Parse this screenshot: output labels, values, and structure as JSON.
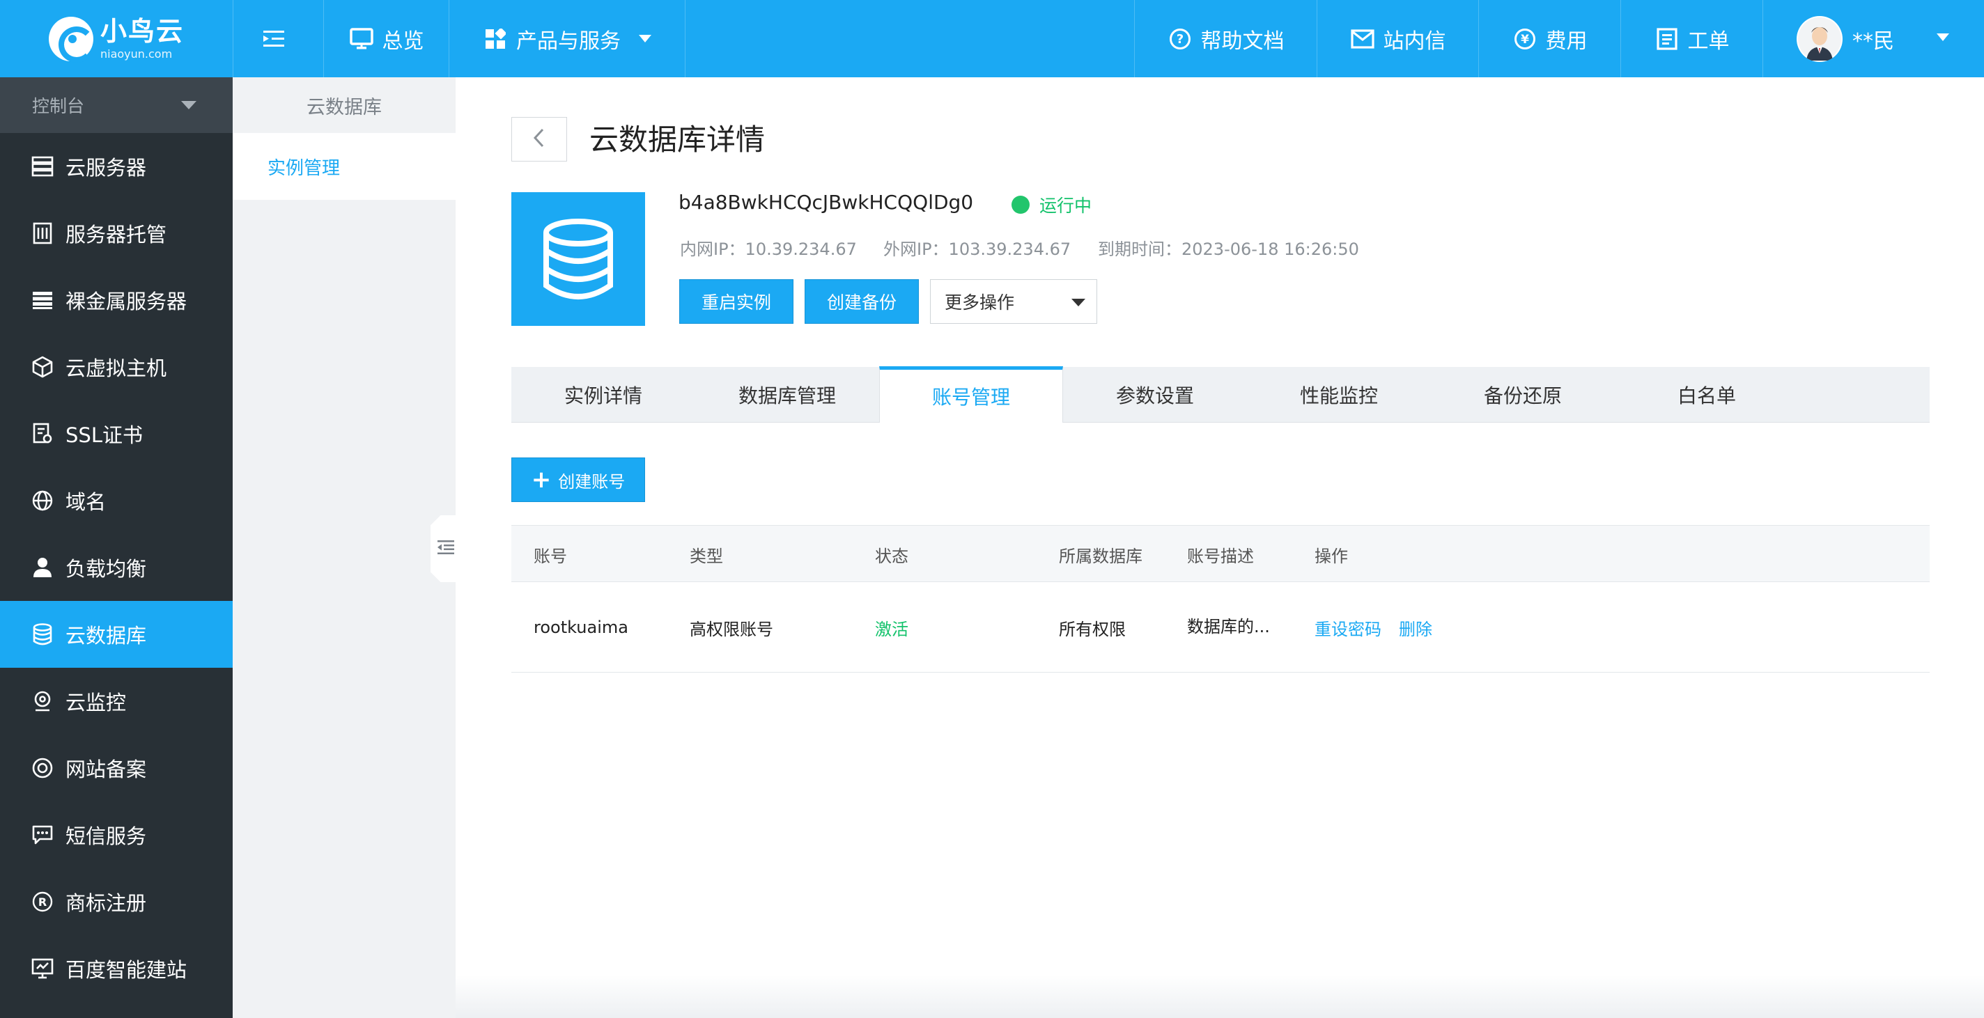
{
  "topbar": {
    "logo_name": "小鸟云",
    "logo_domain": "niaoyun.com",
    "menu_toggle": "",
    "overview": "总览",
    "products": "产品与服务",
    "help": "帮助文档",
    "messages": "站内信",
    "fees": "费用",
    "tickets": "工单",
    "user_name": "**民"
  },
  "leftnav": {
    "console": "控制台",
    "items": [
      {
        "label": "云服务器",
        "icon": "server-icon"
      },
      {
        "label": "服务器托管",
        "icon": "hosting-icon"
      },
      {
        "label": "裸金属服务器",
        "icon": "bare-metal-icon"
      },
      {
        "label": "云虚拟主机",
        "icon": "cube-icon"
      },
      {
        "label": "SSL证书",
        "icon": "certificate-icon"
      },
      {
        "label": "域名",
        "icon": "globe-icon"
      },
      {
        "label": "负载均衡",
        "icon": "load-balancer-icon"
      },
      {
        "label": "云数据库",
        "icon": "database-icon"
      },
      {
        "label": "云监控",
        "icon": "monitor-icon"
      },
      {
        "label": "网站备案",
        "icon": "record-icon"
      },
      {
        "label": "短信服务",
        "icon": "sms-icon"
      },
      {
        "label": "商标注册",
        "icon": "trademark-icon"
      },
      {
        "label": "百度智能建站",
        "icon": "site-builder-icon"
      }
    ],
    "active_index": 7
  },
  "subnav": {
    "heading": "云数据库",
    "item": "实例管理"
  },
  "detail": {
    "title": "云数据库详情",
    "instance_id": "b4a8BwkHCQcJBwkHCQQlDg0",
    "status": "运行中",
    "inner_ip": "内网IP：10.39.234.67",
    "outer_ip": "外网IP：103.39.234.67",
    "expire": "到期时间：2023-06-18 16:26:50",
    "btn_restart": "重启实例",
    "btn_backup": "创建备份",
    "more_ops": "更多操作"
  },
  "tabs": {
    "items": [
      "实例详情",
      "数据库管理",
      "账号管理",
      "参数设置",
      "性能监控",
      "备份还原",
      "白名单"
    ],
    "active_index": 2
  },
  "accounts": {
    "create_label": "创建账号",
    "columns": [
      "账号",
      "类型",
      "状态",
      "所属数据库",
      "账号描述",
      "操作"
    ],
    "rows": [
      {
        "account": "rootkuaima",
        "type": "高权限账号",
        "status": "激活",
        "database": "所有权限",
        "description": "数据库的...",
        "action_reset": "重设密码",
        "action_delete": "删除"
      }
    ]
  },
  "colors": {
    "brand": "#1ba9f3",
    "sidebar": "#283036",
    "success": "#13c26b"
  }
}
